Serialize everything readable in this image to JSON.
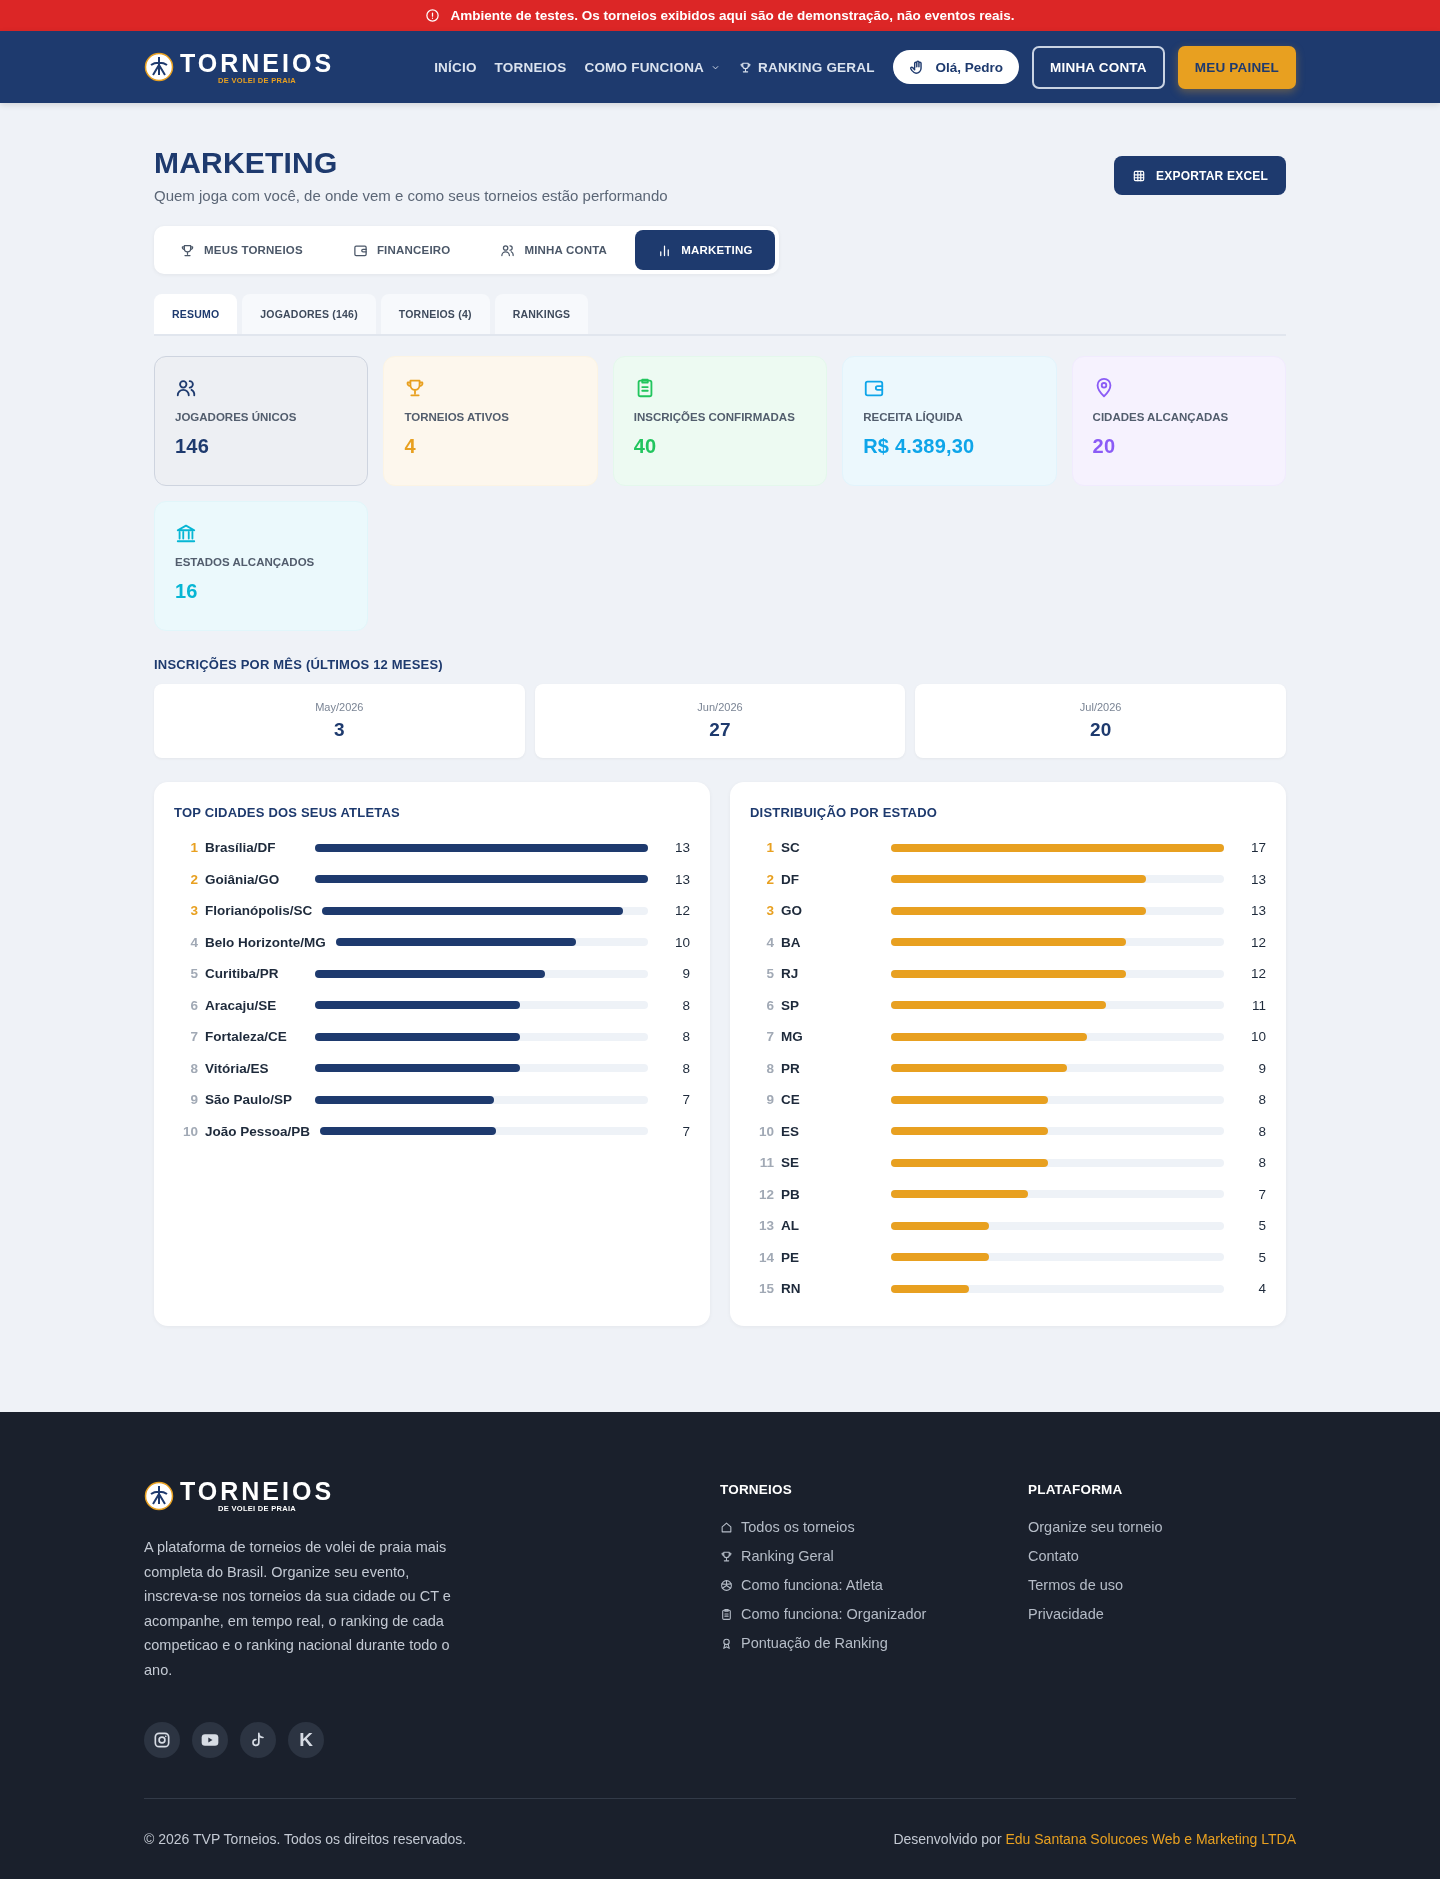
{
  "banner": {
    "text": "Ambiente de testes. Os torneios exibidos aqui são de demonstração, não eventos reais."
  },
  "header": {
    "logo": {
      "title": "TORNEIOS",
      "subtitle": "DE VOLEI DE PRAIA"
    },
    "nav": [
      {
        "label": "INÍCIO",
        "kind": "link"
      },
      {
        "label": "TORNEIOS",
        "kind": "link"
      },
      {
        "label": "COMO FUNCIONA",
        "kind": "dropdown"
      },
      {
        "label": "RANKING GERAL",
        "kind": "trophy"
      }
    ],
    "greeting": "Olá, Pedro",
    "account_button": "MINHA CONTA",
    "panel_button": "MEU PAINEL"
  },
  "page": {
    "title": "MARKETING",
    "subtitle": "Quem joga com você, de onde vem e como seus torneios estão performando",
    "export_button": "EXPORTAR EXCEL"
  },
  "main_tabs": [
    {
      "label": "MEUS TORNEIOS",
      "selected": false
    },
    {
      "label": "FINANCEIRO",
      "selected": false
    },
    {
      "label": "MINHA CONTA",
      "selected": false
    },
    {
      "label": "MARKETING",
      "selected": true
    }
  ],
  "sub_tabs": [
    {
      "label": "RESUMO",
      "selected": true
    },
    {
      "label": "JOGADORES (146)",
      "selected": false
    },
    {
      "label": "TORNEIOS (4)",
      "selected": false
    },
    {
      "label": "RANKINGS",
      "selected": false
    }
  ],
  "stats": [
    {
      "label": "JOGADORES ÚNICOS",
      "value": "146",
      "color": "#1e3a6e"
    },
    {
      "label": "TORNEIOS ATIVOS",
      "value": "4",
      "color": "#e8a020"
    },
    {
      "label": "INSCRIÇÕES CONFIRMADAS",
      "value": "40",
      "color": "#22c55e"
    },
    {
      "label": "RECEITA LÍQUIDA",
      "value": "R$ 4.389,30",
      "color": "#0ea5e9"
    },
    {
      "label": "CIDADES ALCANÇADAS",
      "value": "20",
      "color": "#8b5cf6"
    },
    {
      "label": "ESTADOS ALCANÇADOS",
      "value": "16",
      "color": "#06b6d4"
    }
  ],
  "monthly": {
    "title": "INSCRIÇÕES POR MÊS (ÚLTIMOS 12 MESES)",
    "months": [
      {
        "label": "May/2026",
        "value": "3"
      },
      {
        "label": "Jun/2026",
        "value": "27"
      },
      {
        "label": "Jul/2026",
        "value": "20"
      }
    ]
  },
  "cities": {
    "title": "TOP CIDADES DOS SEUS ATLETAS",
    "rows": [
      {
        "rank": "1",
        "name": "Brasília/DF",
        "value": "13",
        "level": 1,
        "highlight": true
      },
      {
        "rank": "2",
        "name": "Goiânia/GO",
        "value": "13",
        "level": 1,
        "highlight": true
      },
      {
        "rank": "3",
        "name": "Florianópolis/SC",
        "value": "12",
        "level": 0.923,
        "highlight": true
      },
      {
        "rank": "4",
        "name": "Belo Horizonte/MG",
        "value": "10",
        "level": 0.769,
        "highlight": false
      },
      {
        "rank": "5",
        "name": "Curitiba/PR",
        "value": "9",
        "level": 0.692,
        "highlight": false
      },
      {
        "rank": "6",
        "name": "Aracaju/SE",
        "value": "8",
        "level": 0.615,
        "highlight": false
      },
      {
        "rank": "7",
        "name": "Fortaleza/CE",
        "value": "8",
        "level": 0.615,
        "highlight": false
      },
      {
        "rank": "8",
        "name": "Vitória/ES",
        "value": "8",
        "level": 0.615,
        "highlight": false
      },
      {
        "rank": "9",
        "name": "São Paulo/SP",
        "value": "7",
        "level": 0.538,
        "highlight": false
      },
      {
        "rank": "10",
        "name": "João Pessoa/PB",
        "value": "7",
        "level": 0.538,
        "highlight": false
      }
    ]
  },
  "states": {
    "title": "DISTRIBUIÇÃO POR ESTADO",
    "rows": [
      {
        "rank": "1",
        "name": "SC",
        "value": "17",
        "level": 1,
        "highlight": true
      },
      {
        "rank": "2",
        "name": "DF",
        "value": "13",
        "level": 0.765,
        "highlight": true
      },
      {
        "rank": "3",
        "name": "GO",
        "value": "13",
        "level": 0.765,
        "highlight": true
      },
      {
        "rank": "4",
        "name": "BA",
        "value": "12",
        "level": 0.706,
        "highlight": false
      },
      {
        "rank": "5",
        "name": "RJ",
        "value": "12",
        "level": 0.706,
        "highlight": false
      },
      {
        "rank": "6",
        "name": "SP",
        "value": "11",
        "level": 0.647,
        "highlight": false
      },
      {
        "rank": "7",
        "name": "MG",
        "value": "10",
        "level": 0.588,
        "highlight": false
      },
      {
        "rank": "8",
        "name": "PR",
        "value": "9",
        "level": 0.529,
        "highlight": false
      },
      {
        "rank": "9",
        "name": "CE",
        "value": "8",
        "level": 0.471,
        "highlight": false
      },
      {
        "rank": "10",
        "name": "ES",
        "value": "8",
        "level": 0.471,
        "highlight": false
      },
      {
        "rank": "11",
        "name": "SE",
        "value": "8",
        "level": 0.471,
        "highlight": false
      },
      {
        "rank": "12",
        "name": "PB",
        "value": "7",
        "level": 0.412,
        "highlight": false
      },
      {
        "rank": "13",
        "name": "AL",
        "value": "5",
        "level": 0.294,
        "highlight": false
      },
      {
        "rank": "14",
        "name": "PE",
        "value": "5",
        "level": 0.294,
        "highlight": false
      },
      {
        "rank": "15",
        "name": "RN",
        "value": "4",
        "level": 0.235,
        "highlight": false
      }
    ]
  },
  "footer": {
    "logo": {
      "title": "TORNEIOS",
      "subtitle": "DE VOLEI DE PRAIA"
    },
    "description": "A plataforma de torneios de volei de praia mais completa do Brasil. Organize seu evento, inscreva-se nos torneios da sua cidade ou CT e acompanhe, em tempo real, o ranking de cada competicao e o ranking nacional durante todo o ano.",
    "socials": [
      {
        "kind": "instagram"
      },
      {
        "kind": "youtube"
      },
      {
        "kind": "tiktok"
      },
      {
        "kind": "letter",
        "label": "K"
      }
    ],
    "columns": [
      {
        "title": "TORNEIOS",
        "links": [
          "Todos os torneios",
          "Ranking Geral",
          "Como funciona: Atleta",
          "Como funciona: Organizador",
          "Pontuação de Ranking"
        ]
      },
      {
        "title": "PLATAFORMA",
        "links": [
          "Organize seu torneio",
          "Contato",
          "Termos de uso",
          "Privacidade"
        ]
      }
    ],
    "copyright": "© 2026 TVP Torneios. Todos os direitos reservados.",
    "credit_prefix": "Desenvolvido por",
    "credit_link": "Edu Santana Solucoes Web e Marketing LTDA"
  }
}
